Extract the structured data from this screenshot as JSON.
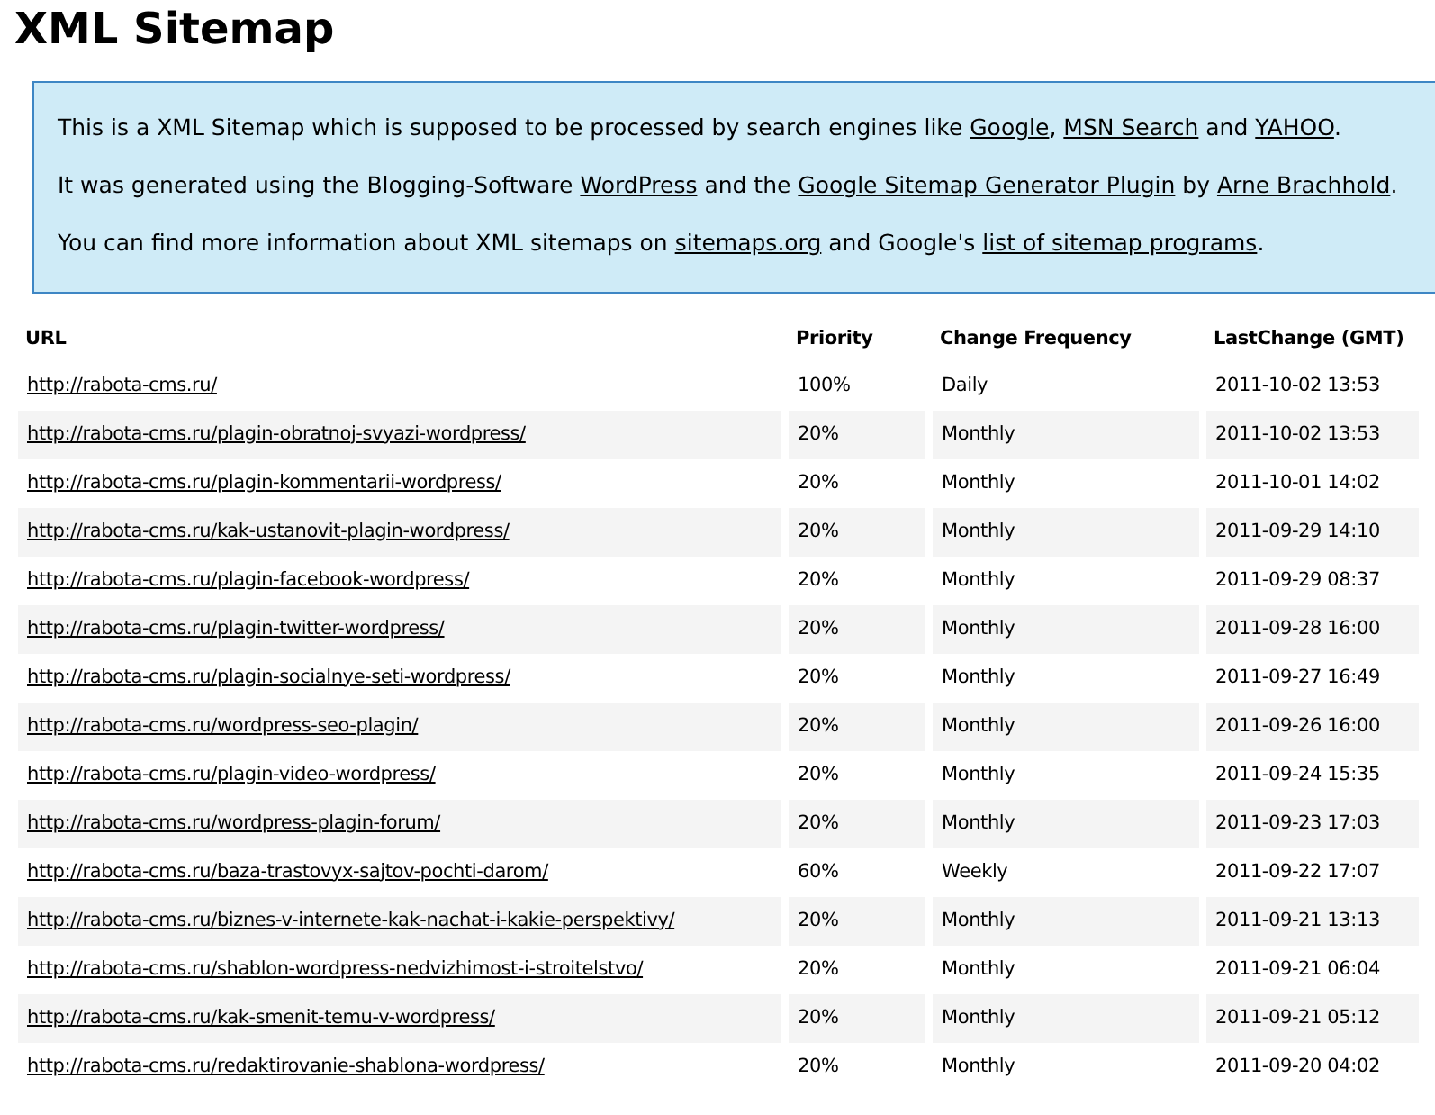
{
  "title": "XML Sitemap",
  "intro": [
    [
      {
        "kind": "text",
        "text": "This is a XML Sitemap which is supposed to be processed by search engines like "
      },
      {
        "kind": "link",
        "text": "Google"
      },
      {
        "kind": "text",
        "text": ", "
      },
      {
        "kind": "link",
        "text": "MSN Search"
      },
      {
        "kind": "text",
        "text": " and "
      },
      {
        "kind": "link",
        "text": "YAHOO"
      },
      {
        "kind": "text",
        "text": "."
      }
    ],
    [
      {
        "kind": "text",
        "text": "It was generated using the Blogging-Software "
      },
      {
        "kind": "link",
        "text": "WordPress"
      },
      {
        "kind": "text",
        "text": " and the "
      },
      {
        "kind": "link",
        "text": "Google Sitemap Generator Plugin"
      },
      {
        "kind": "text",
        "text": " by "
      },
      {
        "kind": "link",
        "text": "Arne Brachhold"
      },
      {
        "kind": "text",
        "text": "."
      }
    ],
    [
      {
        "kind": "text",
        "text": "You can find more information about XML sitemaps on "
      },
      {
        "kind": "link",
        "text": "sitemaps.org"
      },
      {
        "kind": "text",
        "text": " and Google's "
      },
      {
        "kind": "link",
        "text": "list of sitemap programs"
      },
      {
        "kind": "text",
        "text": "."
      }
    ]
  ],
  "table": {
    "columns": [
      "URL",
      "Priority",
      "Change Frequency",
      "LastChange (GMT)"
    ],
    "rows": [
      {
        "url": "http://rabota-cms.ru/",
        "priority": "100%",
        "frequency": "Daily",
        "last_change": "2011-10-02 13:53"
      },
      {
        "url": "http://rabota-cms.ru/plagin-obratnoj-svyazi-wordpress/",
        "priority": "20%",
        "frequency": "Monthly",
        "last_change": "2011-10-02 13:53"
      },
      {
        "url": "http://rabota-cms.ru/plagin-kommentarii-wordpress/",
        "priority": "20%",
        "frequency": "Monthly",
        "last_change": "2011-10-01 14:02"
      },
      {
        "url": "http://rabota-cms.ru/kak-ustanovit-plagin-wordpress/",
        "priority": "20%",
        "frequency": "Monthly",
        "last_change": "2011-09-29 14:10"
      },
      {
        "url": "http://rabota-cms.ru/plagin-facebook-wordpress/",
        "priority": "20%",
        "frequency": "Monthly",
        "last_change": "2011-09-29 08:37"
      },
      {
        "url": "http://rabota-cms.ru/plagin-twitter-wordpress/",
        "priority": "20%",
        "frequency": "Monthly",
        "last_change": "2011-09-28 16:00"
      },
      {
        "url": "http://rabota-cms.ru/plagin-socialnye-seti-wordpress/",
        "priority": "20%",
        "frequency": "Monthly",
        "last_change": "2011-09-27 16:49"
      },
      {
        "url": "http://rabota-cms.ru/wordpress-seo-plagin/",
        "priority": "20%",
        "frequency": "Monthly",
        "last_change": "2011-09-26 16:00"
      },
      {
        "url": "http://rabota-cms.ru/plagin-video-wordpress/",
        "priority": "20%",
        "frequency": "Monthly",
        "last_change": "2011-09-24 15:35"
      },
      {
        "url": "http://rabota-cms.ru/wordpress-plagin-forum/",
        "priority": "20%",
        "frequency": "Monthly",
        "last_change": "2011-09-23 17:03"
      },
      {
        "url": "http://rabota-cms.ru/baza-trastovyx-sajtov-pochti-darom/",
        "priority": "60%",
        "frequency": "Weekly",
        "last_change": "2011-09-22 17:07"
      },
      {
        "url": "http://rabota-cms.ru/biznes-v-internete-kak-nachat-i-kakie-perspektivy/",
        "priority": "20%",
        "frequency": "Monthly",
        "last_change": "2011-09-21 13:13"
      },
      {
        "url": "http://rabota-cms.ru/shablon-wordpress-nedvizhimost-i-stroitelstvo/",
        "priority": "20%",
        "frequency": "Monthly",
        "last_change": "2011-09-21 06:04"
      },
      {
        "url": "http://rabota-cms.ru/kak-smenit-temu-v-wordpress/",
        "priority": "20%",
        "frequency": "Monthly",
        "last_change": "2011-09-21 05:12"
      },
      {
        "url": "http://rabota-cms.ru/redaktirovanie-shablona-wordpress/",
        "priority": "20%",
        "frequency": "Monthly",
        "last_change": "2011-09-20 04:02"
      }
    ]
  }
}
